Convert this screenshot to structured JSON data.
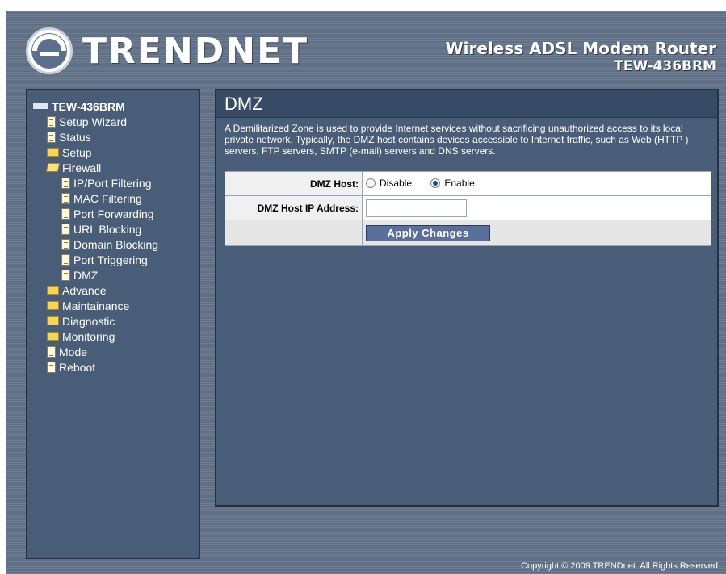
{
  "header": {
    "logo_text": "TRENDNET",
    "product_name": "Wireless ADSL Modem Router",
    "model": "TEW-436BRM"
  },
  "sidebar": {
    "items": [
      {
        "label": "TEW-436BRM",
        "icon": "router-icon",
        "level": 0
      },
      {
        "label": "Setup Wizard",
        "icon": "page-icon",
        "level": 1
      },
      {
        "label": "Status",
        "icon": "page-icon",
        "level": 1
      },
      {
        "label": "Setup",
        "icon": "folder-icon",
        "level": 1
      },
      {
        "label": "Firewall",
        "icon": "folder-open-icon",
        "level": 1
      },
      {
        "label": "IP/Port Filtering",
        "icon": "page-icon",
        "level": 2
      },
      {
        "label": "MAC Filtering",
        "icon": "page-icon",
        "level": 2
      },
      {
        "label": "Port Forwarding",
        "icon": "page-icon",
        "level": 2
      },
      {
        "label": "URL Blocking",
        "icon": "page-icon",
        "level": 2
      },
      {
        "label": "Domain Blocking",
        "icon": "page-icon",
        "level": 2
      },
      {
        "label": "Port Triggering",
        "icon": "page-icon",
        "level": 2
      },
      {
        "label": "DMZ",
        "icon": "page-icon",
        "level": 2
      },
      {
        "label": "Advance",
        "icon": "folder-icon",
        "level": 1
      },
      {
        "label": "Maintainance",
        "icon": "folder-icon",
        "level": 1
      },
      {
        "label": "Diagnostic",
        "icon": "folder-icon",
        "level": 1
      },
      {
        "label": "Monitoring",
        "icon": "folder-icon",
        "level": 1
      },
      {
        "label": "Mode",
        "icon": "page-icon",
        "level": 1
      },
      {
        "label": "Reboot",
        "icon": "page-icon",
        "level": 1
      }
    ]
  },
  "main": {
    "title": "DMZ",
    "description": "A Demilitarized Zone is used to provide Internet services without sacrificing unauthorized access to its local private network. Typically, the DMZ host contains devices accessible to Internet traffic, such as Web (HTTP ) servers, FTP servers, SMTP (e-mail) servers and DNS servers.",
    "form": {
      "dmz_host_label": "DMZ Host:",
      "disable_label": "Disable",
      "enable_label": "Enable",
      "selected": "Enable",
      "ip_label": "DMZ Host IP Address:",
      "ip_value": "",
      "apply_label": "Apply Changes"
    }
  },
  "footer": {
    "copyright": "Copyright © 2009 TRENDnet. All Rights Reserved"
  },
  "colors": {
    "background": "#5f6f86",
    "panel": "#4a5d78",
    "title_bar": "#384b66",
    "button": "#5a6f9c"
  }
}
